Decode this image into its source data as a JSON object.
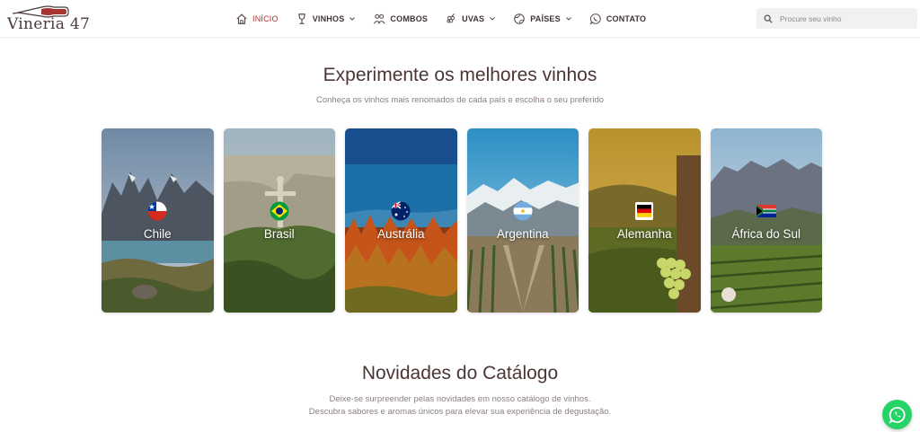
{
  "brand": {
    "logo_text": "Vineria 47"
  },
  "nav": {
    "items": [
      {
        "label": "INÍCIO",
        "icon": "home-icon",
        "active": true,
        "has_dropdown": false
      },
      {
        "label": "VINHOS",
        "icon": "wine-glass-icon",
        "active": false,
        "has_dropdown": true
      },
      {
        "label": "COMBOS",
        "icon": "people-icon",
        "active": false,
        "has_dropdown": false
      },
      {
        "label": "UVAS",
        "icon": "grapes-icon",
        "active": false,
        "has_dropdown": true
      },
      {
        "label": "PAÍSES",
        "icon": "globe-icon",
        "active": false,
        "has_dropdown": true
      },
      {
        "label": "CONTATO",
        "icon": "whatsapp-icon",
        "active": false,
        "has_dropdown": false
      }
    ]
  },
  "search": {
    "placeholder": "Procure seu vinho"
  },
  "section_countries": {
    "title": "Experimente os melhores vinhos",
    "subtitle": "Conheça os vinhos mais renomados de cada país e escolha o seu preferido",
    "cards": [
      {
        "label": "Chile",
        "flag": "chile-flag-icon"
      },
      {
        "label": "Brasil",
        "flag": "brazil-flag-icon"
      },
      {
        "label": "Austrália",
        "flag": "australia-flag-icon"
      },
      {
        "label": "Argentina",
        "flag": "argentina-flag-icon"
      },
      {
        "label": "Alemanha",
        "flag": "germany-flag-icon"
      },
      {
        "label": "África do Sul",
        "flag": "south-africa-flag-icon"
      }
    ]
  },
  "section_news": {
    "title": "Novidades do Catálogo",
    "subtitle_line1": "Deixe-se surpreender pelas novidades em nosso catálogo de vinhos.",
    "subtitle_line2": "Descubra sabores e aromas únicos para elevar sua experiência de degustação."
  },
  "colors": {
    "accent": "#a6352f",
    "text": "#4b3535",
    "whatsapp": "#25d366"
  }
}
